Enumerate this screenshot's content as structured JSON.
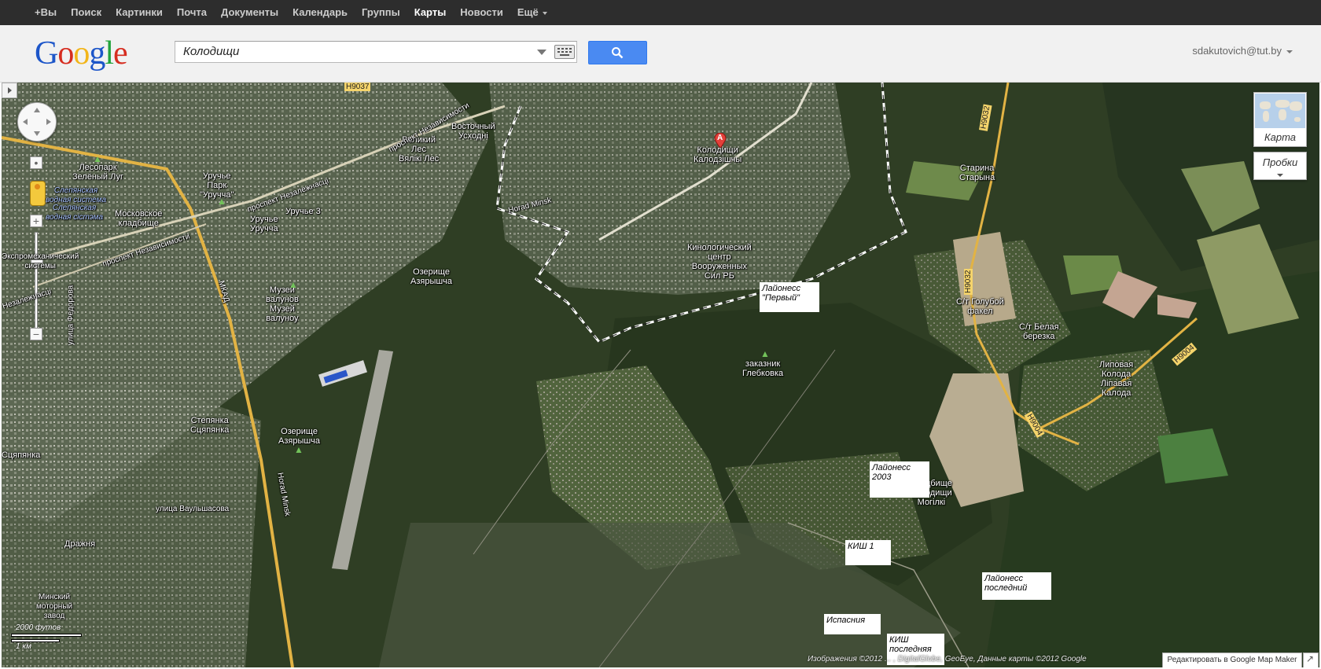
{
  "topbar": {
    "items": [
      {
        "label": "+Вы",
        "active": false
      },
      {
        "label": "Поиск",
        "active": false
      },
      {
        "label": "Картинки",
        "active": false
      },
      {
        "label": "Почта",
        "active": false
      },
      {
        "label": "Документы",
        "active": false
      },
      {
        "label": "Календарь",
        "active": false
      },
      {
        "label": "Группы",
        "active": false
      },
      {
        "label": "Карты",
        "active": true
      },
      {
        "label": "Новости",
        "active": false
      },
      {
        "label": "Ещё",
        "active": false
      }
    ]
  },
  "header": {
    "logo": [
      "G",
      "o",
      "o",
      "g",
      "l",
      "e"
    ],
    "search_value": "Колодищи",
    "account": "sdakutovich@tut.by"
  },
  "controls": {
    "map_type_label": "Карта",
    "traffic_label": "Пробки",
    "scale_top": "2000 футов",
    "scale_bottom": "1 км",
    "attribution": "Изображения ©2012 ... , DigitalGlobe, GeoEye, Данные карты ©2012 Google",
    "edit_link": "Редактировать в Google Map Maker"
  },
  "marker": {
    "letter": "A"
  },
  "places": [
    {
      "id": "lesopark",
      "text": "Лесопарк\nЗелёный Луг"
    },
    {
      "id": "vodn1",
      "text": "Слепянская\nводная система"
    },
    {
      "id": "vodn2",
      "text": "Слепянская\nводная сістэма"
    },
    {
      "id": "moskovskoe",
      "text": "Московское\nкладбище"
    },
    {
      "id": "uruchie-park",
      "text": "Уручье\nПарк\n\"Уручча\""
    },
    {
      "id": "uruchie",
      "text": "Уручье\nУручча"
    },
    {
      "id": "uruchie3",
      "text": "Уручье 3"
    },
    {
      "id": "veliky-les",
      "text": "Великий\nЛес\nВялікі Лес"
    },
    {
      "id": "vostochny",
      "text": "Восточный\nУсходні"
    },
    {
      "id": "kolodischi",
      "text": "Колодищи\nКалодзішчы"
    },
    {
      "id": "kinolog",
      "text": "Кинологический\nцентр\nВооруженных\nСил РБ"
    },
    {
      "id": "ozerische1",
      "text": "Озерище\nАзярышча"
    },
    {
      "id": "muzei",
      "text": "Музей\nвалунов\nМузей\nвалуноу"
    },
    {
      "id": "zakaznik",
      "text": "заказник\nГлебковка"
    },
    {
      "id": "stepyanka",
      "text": "Степянка\nСцяпянка"
    },
    {
      "id": "ozerische2",
      "text": "Озерище\nАзярышча"
    },
    {
      "id": "drazhnya",
      "text": "Дражня"
    },
    {
      "id": "vaulshasova",
      "text": "улица Ваульшасова"
    },
    {
      "id": "minsky-zavod",
      "text": "Минский\nмоторный\nзавод"
    },
    {
      "id": "starina",
      "text": "Старина\nСтарына"
    },
    {
      "id": "golubov",
      "text": "С/т Голубой\nфакел"
    },
    {
      "id": "belaya",
      "text": "С/т Белая\nберезка"
    },
    {
      "id": "lipovaya",
      "text": "Липовая\nКолода\nЛіпавая\nКалода"
    },
    {
      "id": "kladbische",
      "text": "Кладбище\nКолодищи\nМогілкі"
    },
    {
      "id": "horad-minsk",
      "text": "Horad Minsk"
    },
    {
      "id": "prospekt1",
      "text": "проспект Независимости"
    },
    {
      "id": "prospekt2",
      "text": "проспект Незалежнасці"
    },
    {
      "id": "prospekt3",
      "text": "проспект Независимости"
    },
    {
      "id": "mkad",
      "text": "МКАД"
    },
    {
      "id": "horad-minsk-2",
      "text": "Horad Minsk"
    },
    {
      "id": "fedorova",
      "text": "улица Федорова"
    },
    {
      "id": "mikr",
      "text": "Экспромеханический\nсистемы"
    },
    {
      "id": "nezalezh",
      "text": "Незалежнасці"
    },
    {
      "id": "syapanka",
      "text": "Сцяпянка"
    }
  ],
  "roads": [
    {
      "id": "h9037",
      "text": "Н9037"
    },
    {
      "id": "h9032a",
      "text": "Н9032"
    },
    {
      "id": "h9032b",
      "text": "Н9032"
    },
    {
      "id": "h9004a",
      "text": "Н9004"
    },
    {
      "id": "h9004b",
      "text": "Н9004"
    }
  ],
  "notes": [
    {
      "id": "laiones-perviy",
      "text": "Лайонесс\n\"Первый\""
    },
    {
      "id": "laiones-2003",
      "text": "Лайонесс\n2003"
    },
    {
      "id": "kish1",
      "text": "КИШ 1"
    },
    {
      "id": "laiones-posledniy",
      "text": "Лайонесс\nпоследний"
    },
    {
      "id": "ispasnia",
      "text": "Испасния"
    },
    {
      "id": "kish-posledniaya",
      "text": "КИШ\nпоследняя"
    }
  ]
}
